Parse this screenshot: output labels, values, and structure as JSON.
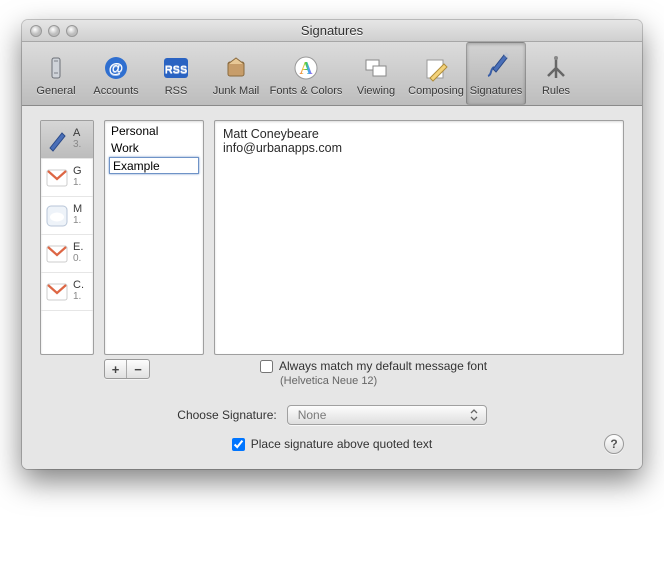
{
  "window": {
    "title": "Signatures"
  },
  "toolbar": [
    {
      "label": "General"
    },
    {
      "label": "Accounts"
    },
    {
      "label": "RSS"
    },
    {
      "label": "Junk Mail"
    },
    {
      "label": "Fonts & Colors"
    },
    {
      "label": "Viewing"
    },
    {
      "label": "Composing"
    },
    {
      "label": "Signatures"
    },
    {
      "label": "Rules"
    }
  ],
  "accounts": [
    {
      "name": "A",
      "sub": "3."
    },
    {
      "name": "G",
      "sub": "1."
    },
    {
      "name": "M",
      "sub": "1."
    },
    {
      "name": "E.",
      "sub": "0."
    },
    {
      "name": "C.",
      "sub": "1."
    }
  ],
  "signatures": {
    "items": [
      "Personal",
      "Work"
    ],
    "editing_value": "Example"
  },
  "preview": {
    "line1": "Matt Coneybeare",
    "line2": "info@urbanapps.com"
  },
  "buttons": {
    "add": "+",
    "remove": "−"
  },
  "font_opt": {
    "label": "Always match my default message font",
    "hint": "(Helvetica Neue 12)",
    "checked": false
  },
  "choose": {
    "label": "Choose Signature:",
    "value": "None"
  },
  "place": {
    "label": "Place signature above quoted text",
    "checked": true
  },
  "help": "?"
}
